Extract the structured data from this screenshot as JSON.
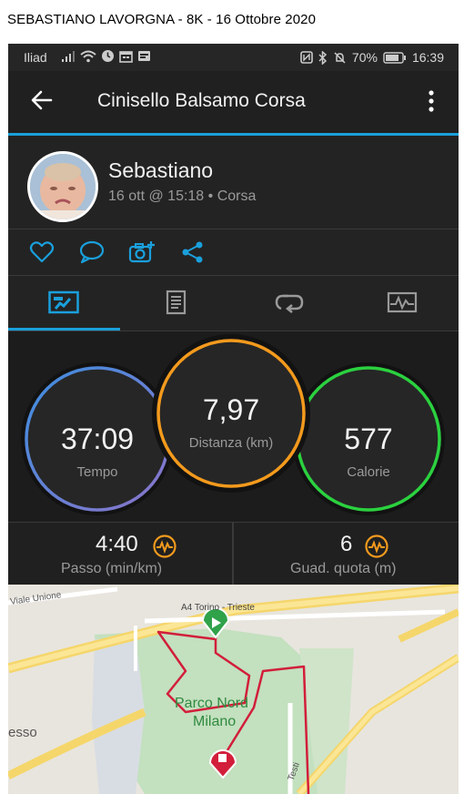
{
  "caption": "SEBASTIANO LAVORGNA  -  8K  -  16 Ottobre 2020",
  "status_bar": {
    "carrier": "Iliad",
    "battery": "70%",
    "time": "16:39"
  },
  "app_bar": {
    "title": "Cinisello Balsamo Corsa",
    "back_icon": "arrow-left-icon",
    "more_icon": "more-vertical-icon"
  },
  "activity": {
    "user_name": "Sebastiano",
    "meta": "16 ott @ 15:18 • Corsa"
  },
  "actions": [
    "heart-icon",
    "comment-icon",
    "add-photo-icon",
    "share-icon"
  ],
  "tabs": [
    {
      "icon": "stats-icon",
      "active": true
    },
    {
      "icon": "details-icon",
      "active": false
    },
    {
      "icon": "laps-icon",
      "active": false
    },
    {
      "icon": "chart-icon",
      "active": false
    }
  ],
  "stats": {
    "time": {
      "value": "37:09",
      "label": "Tempo"
    },
    "distance": {
      "value": "7,97",
      "label": "Distanza (km)"
    },
    "calories": {
      "value": "577",
      "label": "Calorie"
    }
  },
  "metrics": {
    "pace": {
      "value": "4:40",
      "label": "Passo (min/km)"
    },
    "elevation": {
      "value": "6",
      "label": "Guad. quota (m)"
    }
  },
  "map": {
    "labels": {
      "road_top": "Viale Unione",
      "highway": "A4 Torino - Trieste",
      "park": "Parco Nord",
      "city": "Milano",
      "left": "esso",
      "road_bottom": "Testi"
    }
  },
  "colors": {
    "accent": "#1aa0dc",
    "time_ring": "#4a7fd8",
    "distance_ring": "#f39a1d",
    "calories_ring": "#2bd13f",
    "route": "#d21e3a"
  }
}
